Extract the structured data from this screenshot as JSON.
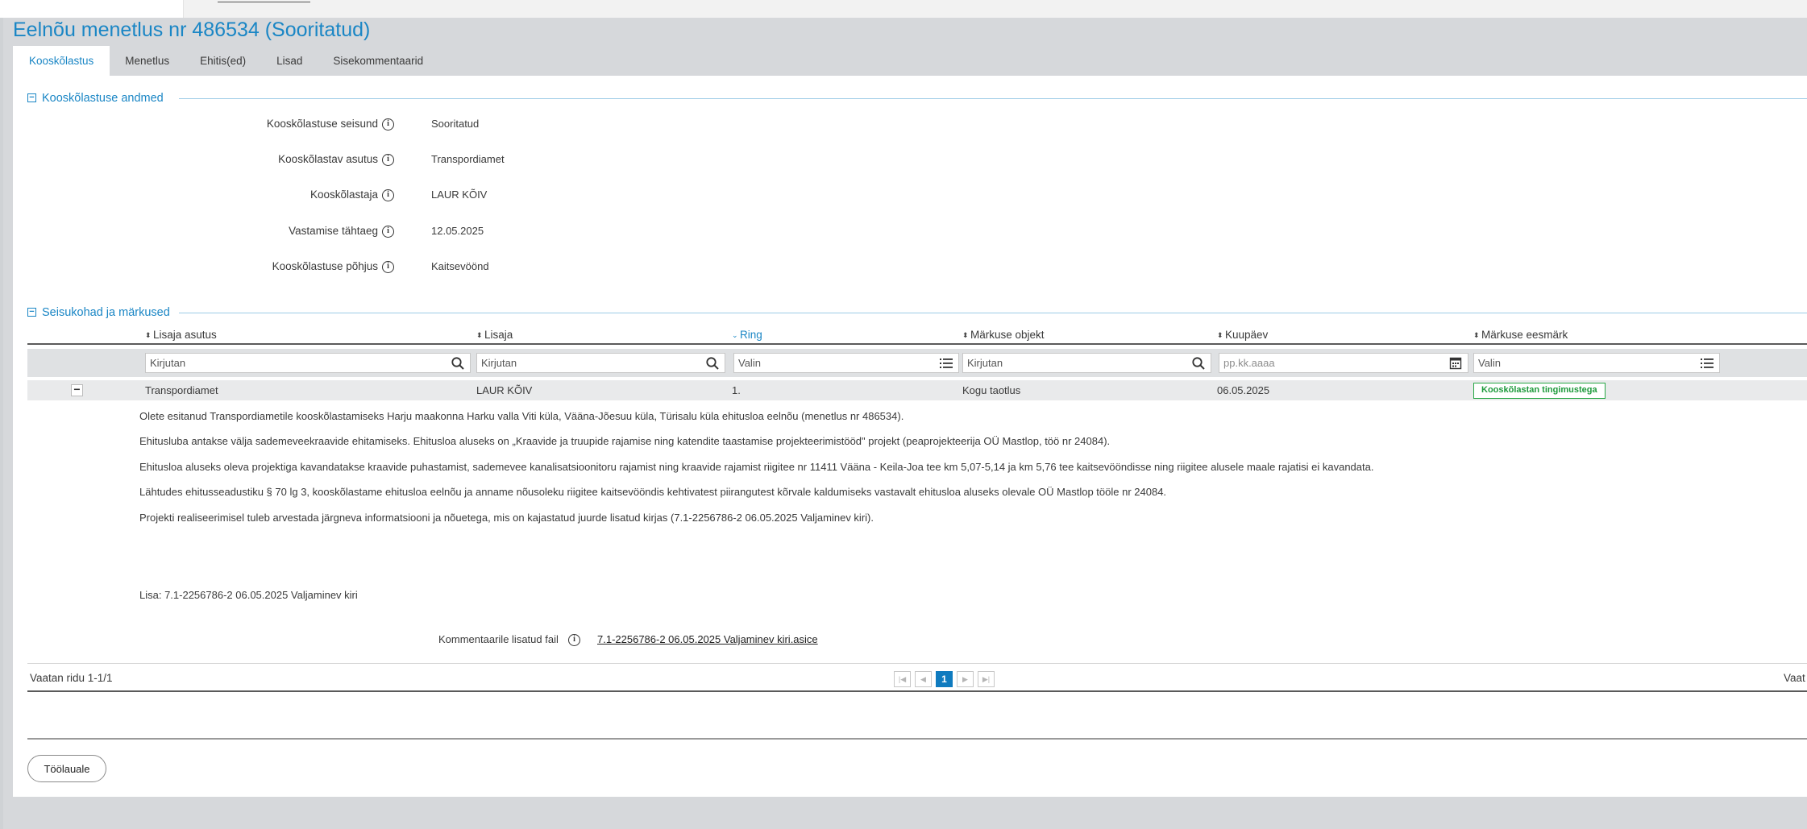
{
  "page": {
    "title": "Eelnõu menetlus nr 486534 (Sooritatud)"
  },
  "tabs": [
    {
      "label": "Kooskõlastus",
      "active": true
    },
    {
      "label": "Menetlus"
    },
    {
      "label": "Ehitis(ed)"
    },
    {
      "label": "Lisad"
    },
    {
      "label": "Sisekommentaarid"
    }
  ],
  "section1": {
    "title": "Kooskõlastuse andmed",
    "fields": [
      {
        "label": "Kooskõlastuse seisund",
        "value": "Sooritatud"
      },
      {
        "label": "Kooskõlastav asutus",
        "value": "Transpordiamet"
      },
      {
        "label": "Kooskõlastaja",
        "value": "LAUR KÕIV"
      },
      {
        "label": "Vastamise tähtaeg",
        "value": "12.05.2025"
      },
      {
        "label": "Kooskõlastuse põhjus",
        "value": "Kaitsevöönd"
      }
    ]
  },
  "section2": {
    "title": "Seisukohad ja märkused",
    "columns": [
      {
        "label": "Lisaja asutus"
      },
      {
        "label": "Lisaja"
      },
      {
        "label": "Ring",
        "sorted": true
      },
      {
        "label": "Märkuse objekt"
      },
      {
        "label": "Kuupäev"
      },
      {
        "label": "Märkuse eesmärk"
      }
    ],
    "filters": [
      {
        "placeholder": "Kirjutan",
        "icon": "search-icon"
      },
      {
        "placeholder": "Kirjutan",
        "icon": "search-icon"
      },
      {
        "placeholder": "Valin",
        "icon": "list-icon"
      },
      {
        "placeholder": "Kirjutan",
        "icon": "search-icon"
      },
      {
        "placeholder": "pp.kk.aaaa",
        "icon": "calendar-icon"
      },
      {
        "placeholder": "Valin",
        "icon": "list-icon"
      }
    ],
    "row": {
      "institution": "Transpordiamet",
      "author": "LAUR KÕIV",
      "round": "1.",
      "object": "Kogu taotlus",
      "date": "06.05.2025",
      "purpose": "Kooskõlastan tingimustega"
    },
    "comment": {
      "paragraphs": [
        "Olete esitanud Transpordiametile kooskõlastamiseks Harju maakonna Harku valla Viti küla, Vääna-Jõesuu küla, Türisalu küla ehitusloa eelnõu (menetlus nr 486534).",
        "Ehitusluba antakse välja sademeveekraavide ehitamiseks. Ehitusloa aluseks on „Kraavide ja truupide rajamise ning katendite taastamise projekteerimistööd\" projekt (peaprojekteerija OÜ Mastlop, töö nr 24084).",
        "Ehitusloa aluseks oleva projektiga kavandatakse kraavide puhastamist, sademevee kanalisatsioonitoru rajamist ning kraavide rajamist riigitee nr 11411 Vääna - Keila-Joa tee km 5,07-5,14 ja km 5,76 tee kaitsevööndisse ning riigitee alusele maale rajatisi ei kavandata.",
        "Lähtudes ehitusseadustiku § 70 lg 3, kooskõlastame ehitusloa eelnõu ja anname nõusoleku riigitee kaitsevööndis kehtivatest piirangutest kõrvale kaldumiseks vastavalt ehitusloa aluseks olevale OÜ Mastlop tööle nr 24084.",
        "Projekti realiseerimisel tuleb arvestada järgneva informatsiooni ja nõuetega, mis on kajastatud juurde lisatud kirjas (7.1-2256786-2 06.05.2025 Valjaminev kiri)."
      ],
      "attachment_note": "Lisa: 7.1-2256786-2 06.05.2025 Valjaminev kiri",
      "file_label": "Kommentaarile lisatud fail",
      "file_name": "7.1-2256786-2 06.05.2025 Valjaminev kiri.asice"
    },
    "footer": {
      "rows_info": "Vaatan ridu 1-1/1",
      "rows_info_right": "Vaat",
      "current_page": "1"
    }
  },
  "actions": {
    "back_label": "Töölauale"
  },
  "colors": {
    "accent": "#1a86c5",
    "success": "#27a745",
    "page_bg": "#d6d8db"
  }
}
